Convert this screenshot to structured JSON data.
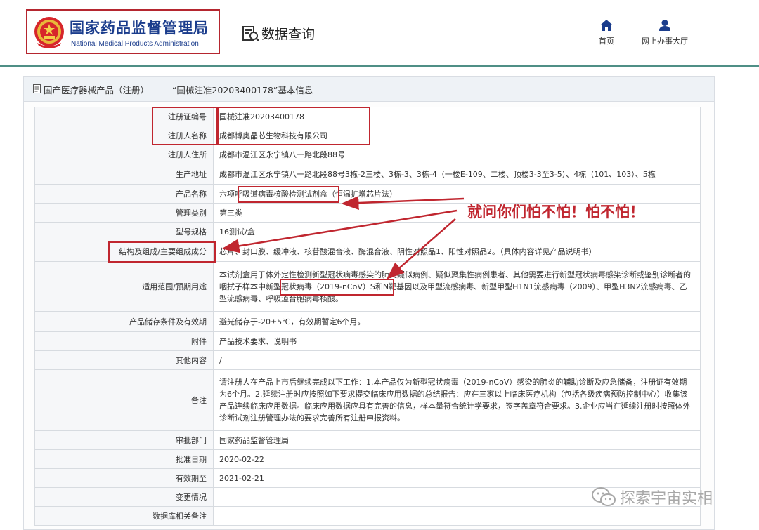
{
  "header": {
    "site_title": "国家药品监督管理局",
    "site_subtitle": "National Medical Products Administration",
    "data_query": "数据查询",
    "nav": [
      {
        "label": "首页",
        "icon": "home-icon"
      },
      {
        "label": "网上办事大厅",
        "icon": "user-icon"
      }
    ]
  },
  "panel": {
    "title": "国产医疗器械产品（注册） —— “国械注准20203400178”基本信息"
  },
  "rows": [
    {
      "label": "注册证编号",
      "value": "国械注准20203400178"
    },
    {
      "label": "注册人名称",
      "value": "成都博奥晶芯生物科技有限公司"
    },
    {
      "label": "注册人住所",
      "value": "成都市温江区永宁镇八一路北段88号"
    },
    {
      "label": "生产地址",
      "value": "成都市温江区永宁镇八一路北段88号3栋-2三楼、3栋-3、3栋-4（一楼E-109、二楼、顶楼3-3至3-5）、4栋（101、103）、5栋"
    },
    {
      "label": "产品名称",
      "value": "六项呼吸道病毒核酸检测试剂盒（恒温扩增芯片法）"
    },
    {
      "label": "管理类别",
      "value": "第三类"
    },
    {
      "label": "型号规格",
      "value": "16测试/盒"
    },
    {
      "label": "结构及组成/主要组成成分",
      "value": "芯片、封口膜、缓冲液、核苷酸混合液、酶混合液、阴性对照品1、阳性对照品2。（具体内容详见产品说明书）"
    },
    {
      "label": "适用范围/预期用途",
      "value": "本试剂盒用于体外定性检测新型冠状病毒感染的肺炎疑似病例、疑似聚集性病例患者、其他需要进行新型冠状病毒感染诊断或鉴别诊断者的咽拭子样本中新型冠状病毒（2019-nCoV）S和N靶基因以及甲型流感病毒、新型甲型H1N1流感病毒（2009）、甲型H3N2流感病毒、乙型流感病毒、呼吸道合胞病毒核酸。"
    },
    {
      "label": "产品储存条件及有效期",
      "value": "避光储存于-20±5℃，有效期暂定6个月。"
    },
    {
      "label": "附件",
      "value": "产品技术要求、说明书"
    },
    {
      "label": "其他内容",
      "value": "/"
    },
    {
      "label": "备注",
      "value": "请注册人在产品上市后继续完成以下工作：1.本产品仅为新型冠状病毒（2019-nCoV）感染的肺炎的辅助诊断及应急储备，注册证有效期为6个月。2.延续注册时应按照如下要求提交临床应用数据的总结报告：应在三家以上临床医疗机构（包括各级疾病预防控制中心）收集该产品连续临床应用数据。临床应用数据应具有完善的信息，样本量符合统计学要求，签字盖章符合要求。3.企业应当在延续注册时按照体外诊断试剂注册管理办法的要求完善所有注册申报资料。"
    },
    {
      "label": "审批部门",
      "value": "国家药品监督管理局"
    },
    {
      "label": "批准日期",
      "value": "2020-02-22"
    },
    {
      "label": "有效期至",
      "value": "2021-02-21"
    },
    {
      "label": "变更情况",
      "value": ""
    },
    {
      "label": "数据库相关备注",
      "value": ""
    }
  ],
  "annotation": {
    "callout": "就问你们怕不怕！怕不怕！",
    "color": "#c0262f"
  },
  "watermark": "探索宇宙实相",
  "colors": {
    "brand_blue": "#1a3c8c",
    "accent_red": "#c0262f",
    "header_rule": "#4f8f86"
  }
}
